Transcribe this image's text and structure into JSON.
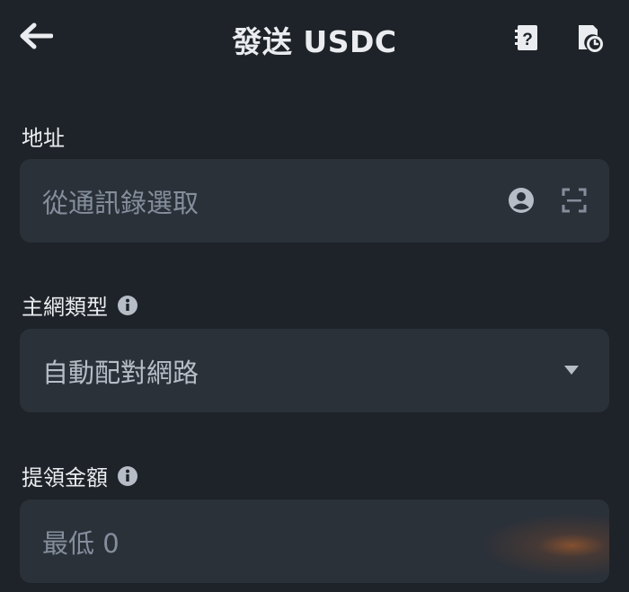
{
  "header": {
    "title": "發送 USDC",
    "back_icon": "arrow-left-icon",
    "address_book_icon": "address-book-icon",
    "history_icon": "history-icon"
  },
  "address": {
    "label": "地址",
    "placeholder": "從通訊錄選取",
    "contact_icon": "contact-icon",
    "scan_icon": "scan-icon"
  },
  "network": {
    "label": "主網類型",
    "info_icon": "info-icon",
    "value": "自動配對網路",
    "dropdown_icon": "caret-down-icon"
  },
  "amount": {
    "label": "提領金額",
    "info_icon": "info-icon",
    "placeholder": "最低 0"
  },
  "colors": {
    "background": "#1e2329",
    "field_background": "#2b3139",
    "text_primary": "#eaecef",
    "text_secondary": "#848e9c"
  }
}
